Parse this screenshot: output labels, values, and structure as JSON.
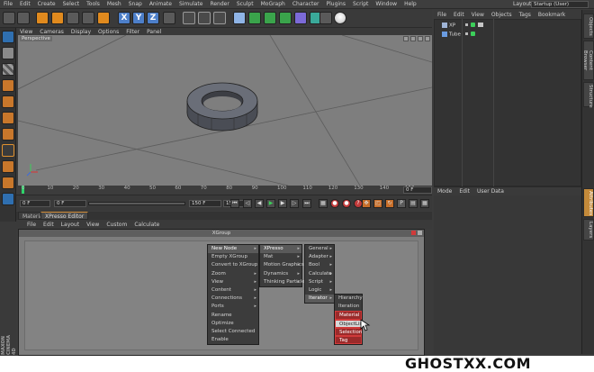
{
  "menubar": {
    "items": [
      "File",
      "Edit",
      "Create",
      "Select",
      "Tools",
      "Mesh",
      "Snap",
      "Animate",
      "Simulate",
      "Render",
      "Sculpt",
      "MoGraph",
      "Character",
      "Plugins",
      "Script",
      "Window",
      "Help"
    ],
    "layout_label": "Layout:",
    "layout_value": "Startup (User)"
  },
  "toolbar": {
    "axis_x": "X",
    "axis_y": "Y",
    "axis_z": "Z"
  },
  "viewport": {
    "menu": [
      "View",
      "Cameras",
      "Display",
      "Options",
      "Filter",
      "Panel"
    ],
    "label": "Perspective"
  },
  "timeline": {
    "ticks": [
      "0",
      "10",
      "20",
      "30",
      "40",
      "50",
      "60",
      "70",
      "80",
      "90",
      "100",
      "110",
      "120",
      "130",
      "140",
      "150"
    ],
    "current_frame": "0 F"
  },
  "transport": {
    "start_field": "0 F",
    "min_field": "0 F",
    "max_field": "150 F",
    "end_field": "150 F"
  },
  "object_manager": {
    "menu": [
      "File",
      "Edit",
      "View",
      "Objects",
      "Tags",
      "Bookmark"
    ],
    "objects": [
      {
        "name": "XP",
        "icon_color": "#9fb4d6"
      },
      {
        "name": "Tube",
        "icon_color": "#6a9be0"
      }
    ]
  },
  "attributes": {
    "menu": [
      "Mode",
      "Edit",
      "User Data"
    ]
  },
  "side_tabs": [
    "Objects",
    "Content Browser",
    "Structure",
    "Attributes",
    "Layers"
  ],
  "bottom_tabs": [
    "Materials",
    "XPresso Editor"
  ],
  "xpresso": {
    "menu": [
      "File",
      "Edit",
      "Layout",
      "View",
      "Custom",
      "Calculate"
    ],
    "group_title": "XGroup"
  },
  "context_menu": {
    "main": [
      "New Node",
      "Empty XGroup",
      "Convert to XGroup",
      "Zoom",
      "View",
      "Content",
      "Connections",
      "Ports",
      "Rename",
      "Optimize",
      "Select Connected",
      "Enable"
    ],
    "xpresso_sub": [
      "XPresso",
      "Mat",
      "Motion Graphics",
      "Dynamics",
      "Thinking Particles"
    ],
    "general_sub": [
      "General",
      "Adapter",
      "Bool",
      "Calculate",
      "Script",
      "Logic",
      "Iterator"
    ],
    "iterator_sub": [
      "Hierarchy",
      "Iteration",
      "Material",
      "ObjectList",
      "Selection",
      "Tag"
    ]
  },
  "branding": {
    "maxon": "MAXON CINEMA 4D",
    "watermark": "GHOSTXX.COM"
  }
}
